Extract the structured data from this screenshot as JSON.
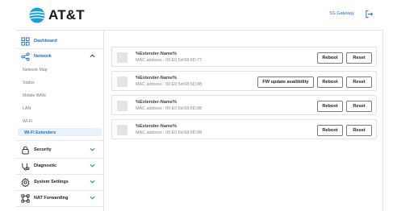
{
  "header": {
    "brand": "AT&T",
    "gateway_link": "5G Gateway"
  },
  "sidebar": {
    "dashboard": "Dashboard",
    "network": {
      "label": "Network",
      "items": [
        "Network Map",
        "Status",
        "Mobile WAN",
        "LAN",
        "Wi-Fi"
      ],
      "active_item": "Wi-Fi Extenders"
    },
    "security": "Security",
    "diagnostic": "Diagnostic",
    "system_settings": "System Settings",
    "nat_forwarding": "NAT Forwarding"
  },
  "extenders": [
    {
      "name": "%Extender-Name%",
      "mac": "MAC address : 00:E0:5d:68:6D:77",
      "fw_update": ""
    },
    {
      "name": "%Extender-Name%",
      "mac": "MAC address : 00:E0:5d:68:6D:88",
      "fw_update": "FW update availibility"
    },
    {
      "name": "%Extender-Name%",
      "mac": "MAC address : 00:E0:5d:68:6D:88",
      "fw_update": ""
    },
    {
      "name": "%Extender-Name%",
      "mac": "MAC address : 00:E0:5d:68:6D:88",
      "fw_update": ""
    }
  ],
  "buttons": {
    "reboot": "Reboot",
    "reset": "Reset"
  },
  "colors": {
    "accent": "#1a6fd1",
    "active_bg": "#e9f2fc"
  }
}
